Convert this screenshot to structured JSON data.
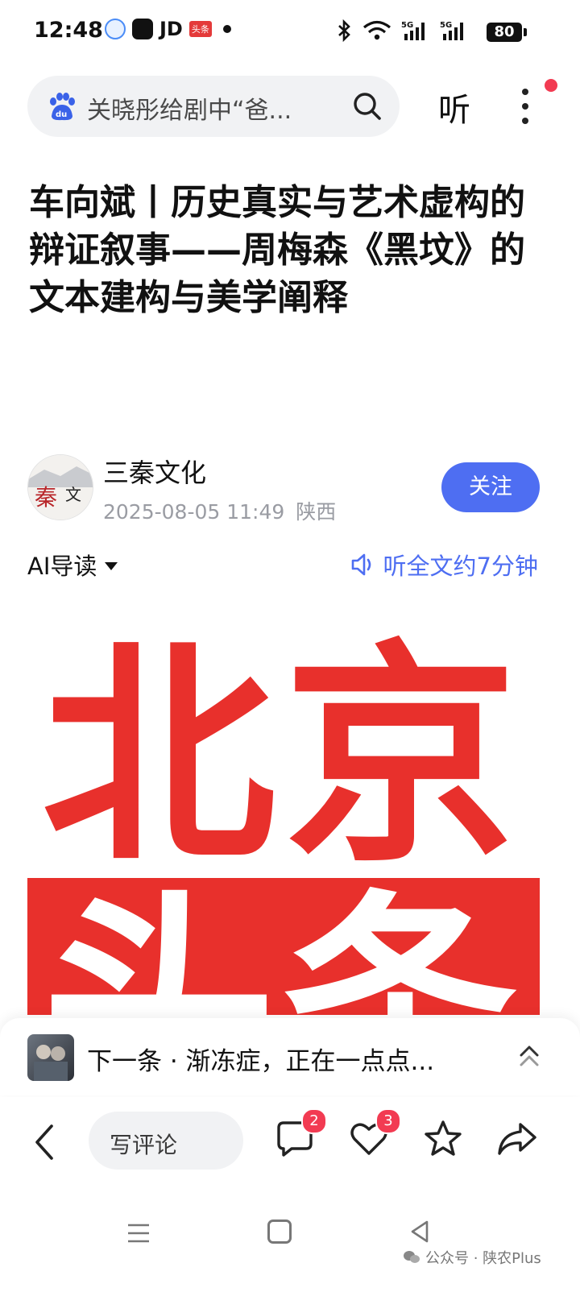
{
  "status_bar": {
    "time": "12:48",
    "jd_label": "JD",
    "toutiao_label": "头条",
    "battery": "80"
  },
  "search": {
    "query": "关晓彤给剧中“爸...",
    "listen_label": "听"
  },
  "article": {
    "title": "车向斌丨历史真实与艺术虚构的辩证叙事——周梅森《黑坟》的文本建构与美学阐释",
    "author": "三秦文化",
    "date": "2025-08-05 11:49",
    "location": "陕西",
    "follow_label": "关注",
    "avatar_text_a": "秦",
    "avatar_text_b": "文",
    "ai_read_label": "AI导读",
    "listen_full_label": "听全文约7分钟",
    "image_text_line1": "北京",
    "image_text_line2": "头条"
  },
  "next": {
    "label": "下一条 · 渐冻症，正在一点点..."
  },
  "toolbar": {
    "comment_placeholder": "写评论",
    "comment_count": "2",
    "like_count": "3"
  },
  "watermark": {
    "text": "公众号 · 陕农Plus"
  },
  "colors": {
    "accent": "#4e6ef2",
    "badge_red": "#f23b52",
    "image_red": "#e8302c"
  }
}
